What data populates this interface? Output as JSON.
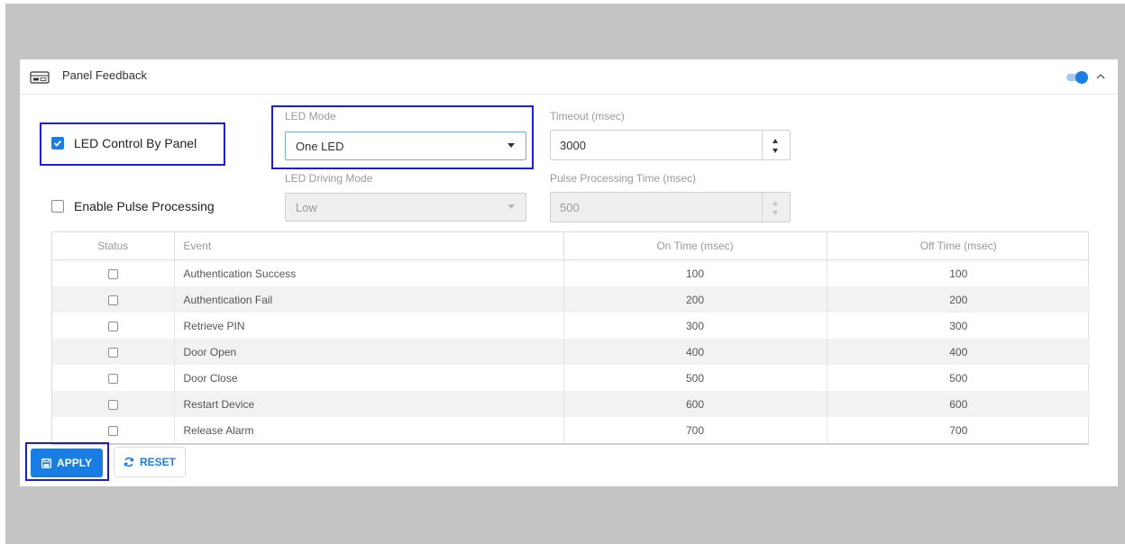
{
  "panel": {
    "title": "Panel Feedback",
    "header_icon": "panel-icon",
    "toggle_state": "on",
    "collapse_icon": "chevron-up-icon"
  },
  "options": {
    "led_control": {
      "label": "LED Control By Panel",
      "checked": true
    },
    "pulse_processing": {
      "label": "Enable Pulse Processing",
      "checked": false
    }
  },
  "fields": {
    "led_mode": {
      "label": "LED Mode",
      "value": "One LED"
    },
    "timeout": {
      "label": "Timeout (msec)",
      "value": "3000"
    },
    "led_driving_mode": {
      "label": "LED Driving Mode",
      "value": "Low"
    },
    "pulse_time": {
      "label": "Pulse Processing Time (msec)",
      "value": "500"
    }
  },
  "table": {
    "columns": [
      "Status",
      "Event",
      "On Time (msec)",
      "Off Time (msec)"
    ],
    "rows": [
      {
        "event": "Authentication Success",
        "on": "100",
        "off": "100"
      },
      {
        "event": "Authentication Fail",
        "on": "200",
        "off": "200"
      },
      {
        "event": "Retrieve PIN",
        "on": "300",
        "off": "300"
      },
      {
        "event": "Door Open",
        "on": "400",
        "off": "400"
      },
      {
        "event": "Door Close",
        "on": "500",
        "off": "500"
      },
      {
        "event": "Restart Device",
        "on": "600",
        "off": "600"
      },
      {
        "event": "Release Alarm",
        "on": "700",
        "off": "700"
      }
    ]
  },
  "buttons": {
    "apply": "APPLY",
    "reset": "RESET"
  },
  "colors": {
    "accent": "#1a7de3",
    "highlight": "#1d1dd6",
    "backdrop": "#c4c4c4"
  }
}
